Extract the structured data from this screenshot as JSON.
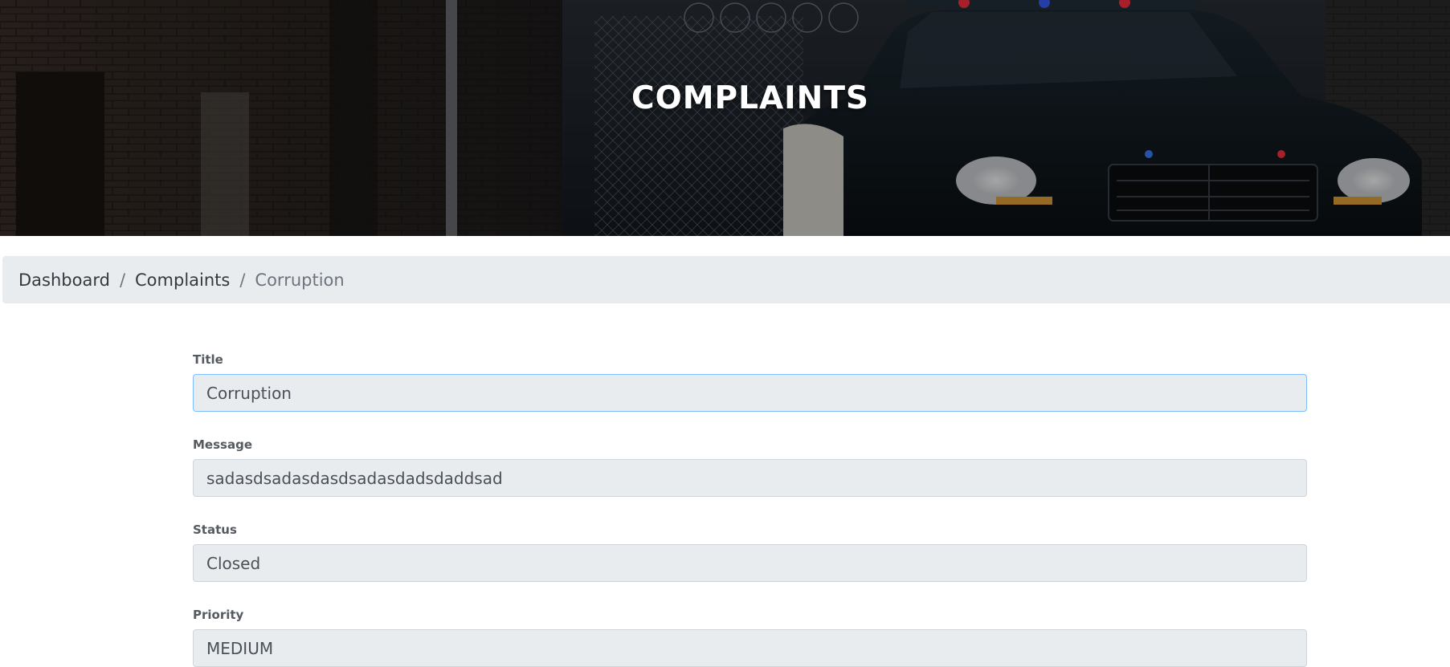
{
  "hero": {
    "title": "COMPLAINTS"
  },
  "breadcrumb": {
    "items": [
      {
        "label": "Dashboard",
        "active": false
      },
      {
        "label": "Complaints",
        "active": false
      },
      {
        "label": "Corruption",
        "active": true
      }
    ],
    "separator": "/"
  },
  "form": {
    "fields": [
      {
        "label": "Title",
        "value": "Corruption"
      },
      {
        "label": "Message",
        "value": "sadasdsadasdasdsadasdadsdaddsad"
      },
      {
        "label": "Status",
        "value": "Closed"
      },
      {
        "label": "Priority",
        "value": "MEDIUM"
      }
    ]
  },
  "colors": {
    "breadcrumb_bg": "#e9ecef",
    "input_bg": "#e9ecef",
    "focus_border": "#80bdff"
  }
}
